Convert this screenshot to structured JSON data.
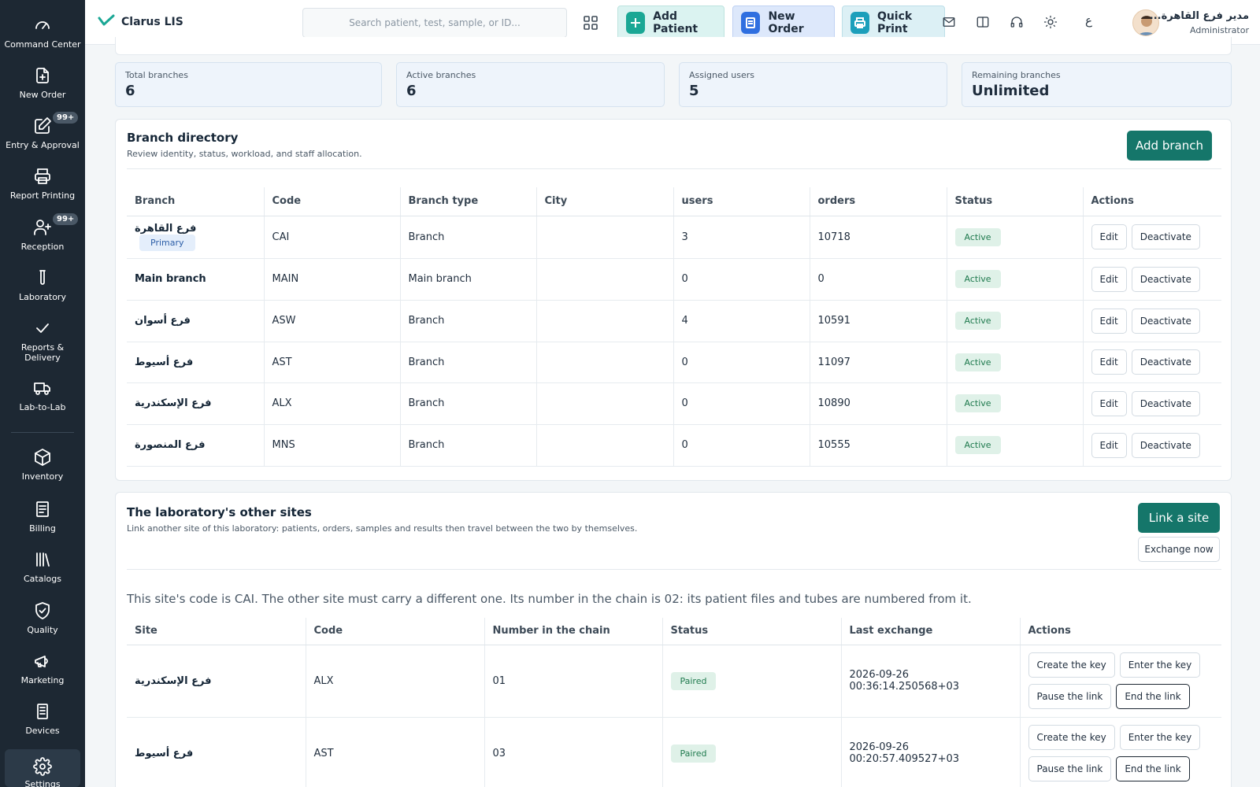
{
  "sidebar": {
    "items": [
      {
        "label": "Command Center",
        "icon": "gauge-icon"
      },
      {
        "label": "New Order",
        "icon": "file-plus-icon"
      },
      {
        "label": "Entry & Approval",
        "icon": "edit-icon",
        "badge": "99+"
      },
      {
        "label": "Report Printing",
        "icon": "printer-icon"
      },
      {
        "label": "Reception",
        "icon": "user-plus-icon",
        "badge": "99+"
      },
      {
        "label": "Laboratory",
        "icon": "test-tube-icon"
      },
      {
        "label": "Reports & Delivery",
        "icon": "check-icon"
      },
      {
        "label": "Lab-to-Lab",
        "icon": "truck-icon"
      },
      {
        "label": "Inventory",
        "icon": "box-icon"
      },
      {
        "label": "Billing",
        "icon": "receipt-icon"
      },
      {
        "label": "Catalogs",
        "icon": "library-icon"
      },
      {
        "label": "Quality",
        "icon": "shield-check-icon"
      },
      {
        "label": "Marketing",
        "icon": "megaphone-icon"
      },
      {
        "label": "Devices",
        "icon": "server-icon"
      },
      {
        "label": "Settings",
        "icon": "gear-icon"
      }
    ]
  },
  "topbar": {
    "brand": "Clarus LIS",
    "search_placeholder": "Search patient, test, sample, or ID...",
    "add_patient": "Add Patient",
    "new_order": "New Order",
    "quick_print": "Quick Print",
    "lang_toggle": "ع",
    "user_name": "مدير فرع القاهرة...",
    "user_role": "Administrator"
  },
  "stats": [
    {
      "label": "Total branches",
      "value": "6"
    },
    {
      "label": "Active branches",
      "value": "6"
    },
    {
      "label": "Assigned users",
      "value": "5"
    },
    {
      "label": "Remaining branches",
      "value": "Unlimited"
    }
  ],
  "branch_directory": {
    "title": "Branch directory",
    "subtitle": "Review identity, status, workload, and staff allocation.",
    "add_button": "Add branch",
    "columns": [
      "Branch",
      "Code",
      "Branch type",
      "City",
      "users",
      "orders",
      "Status",
      "Actions"
    ],
    "primary_tag": "Primary",
    "edit_label": "Edit",
    "deactivate_label": "Deactivate",
    "rows": [
      {
        "branch": "فرع القاهرة",
        "code": "CAI",
        "type": "Branch",
        "city": "",
        "users": "3",
        "orders": "10718",
        "status": "Active",
        "primary": true
      },
      {
        "branch": "Main branch",
        "code": "MAIN",
        "type": "Main branch",
        "city": "",
        "users": "0",
        "orders": "0",
        "status": "Active"
      },
      {
        "branch": "فرع أسوان",
        "code": "ASW",
        "type": "Branch",
        "city": "",
        "users": "4",
        "orders": "10591",
        "status": "Active"
      },
      {
        "branch": "فرع أسيوط",
        "code": "AST",
        "type": "Branch",
        "city": "",
        "users": "0",
        "orders": "11097",
        "status": "Active"
      },
      {
        "branch": "فرع الإسكندرية",
        "code": "ALX",
        "type": "Branch",
        "city": "",
        "users": "0",
        "orders": "10890",
        "status": "Active"
      },
      {
        "branch": "فرع المنصورة",
        "code": "MNS",
        "type": "Branch",
        "city": "",
        "users": "0",
        "orders": "10555",
        "status": "Active"
      }
    ]
  },
  "other_sites": {
    "title": "The laboratory's other sites",
    "subtitle": "Link another site of this laboratory: patients, orders, samples and results then travel between the two by themselves.",
    "link_button": "Link a site",
    "exchange_button": "Exchange now",
    "note": "This site's code is CAI. The other site must carry a different one. Its number in the chain is 02: its patient files and tubes are numbered from it.",
    "columns": [
      "Site",
      "Code",
      "Number in the chain",
      "Status",
      "Last exchange",
      "Actions"
    ],
    "create_key": "Create the key",
    "enter_key": "Enter the key",
    "pause_link": "Pause the link",
    "end_link": "End the link",
    "rows": [
      {
        "site": "فرع الإسكندرية",
        "code": "ALX",
        "number": "01",
        "status": "Paired",
        "last_exchange": "2026-09-26 00:36:14.250568+03"
      },
      {
        "site": "فرع أسيوط",
        "code": "AST",
        "number": "03",
        "status": "Paired",
        "last_exchange": "2026-09-26 00:20:57.409527+03"
      }
    ]
  }
}
